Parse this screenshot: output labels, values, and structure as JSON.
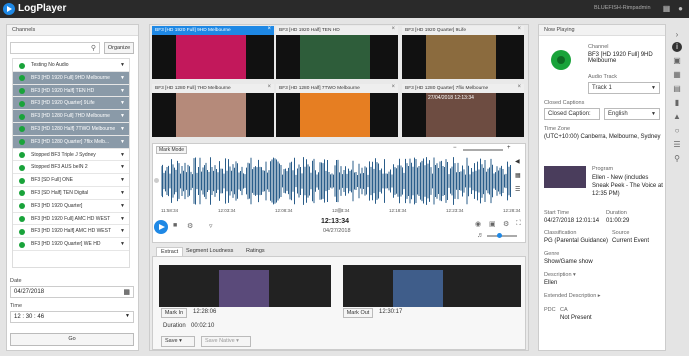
{
  "app": {
    "title": "LogPlayer",
    "user": "BLUEFISH-Rimpadmin"
  },
  "channels": {
    "header": "Channels",
    "organize_label": "Organize",
    "items": [
      {
        "label": "Testing No Audio",
        "selected": false
      },
      {
        "label": "BF3 [HD 1920 Full] 9HD Melbourne",
        "selected": true
      },
      {
        "label": "BF3 [HD 1920 Half] TEN HD",
        "selected": true
      },
      {
        "label": "BF3 [HD 1920 Quarter] 9Life",
        "selected": true
      },
      {
        "label": "BF3 [HD 1280 Full] 7HD Melbourne",
        "selected": true
      },
      {
        "label": "BF3 [HD 1280 Half] 7TWO Melbourne",
        "selected": true
      },
      {
        "label": "BF3 [HD 1280 Quarter] 7flix Melb...",
        "selected": true
      },
      {
        "label": "Stopped BF3 Triple J Sydney",
        "selected": false
      },
      {
        "label": "Stopped BF3 AUS beIN 2",
        "selected": false
      },
      {
        "label": "BF3 [SD Full] ONE",
        "selected": false
      },
      {
        "label": "BF3 [SD Half] TEN Digital",
        "selected": false
      },
      {
        "label": "BF3 [HD 1920 Quarter]",
        "selected": false
      },
      {
        "label": "BF3 [HD 1920 Full] AMC HD WEST",
        "selected": false
      },
      {
        "label": "BF3 [HD 1920 Half] AMC HD WEST",
        "selected": false
      },
      {
        "label": "BF3 [HD 1920 Quarter] WE HD",
        "selected": false
      }
    ],
    "date_label": "Date",
    "date_value": "04/27/2018",
    "time_label": "Time",
    "time_h": "12",
    "time_m": "30",
    "time_s": "46",
    "go_label": "Go"
  },
  "monitors": [
    {
      "label": "BF3 [HD 1920 Full] 9HD Melbourne",
      "active": true,
      "color": "#c2185b"
    },
    {
      "label": "BF3 [HD 1920 Half] TEN HD",
      "active": false,
      "color": "#2e5d3a"
    },
    {
      "label": "BF3 [HD 1920 Quarter] 9Life",
      "active": false,
      "color": "#8b6b3e"
    },
    {
      "label": "BF3 [HD 1280 Full] 7HD Melbourne",
      "active": false,
      "color": "#b58a7a"
    },
    {
      "label": "BF3 [HD 1280 Half] 7TWO Melbourne",
      "active": false,
      "color": "#e67e22"
    },
    {
      "label": "BF3 [HD 1280 Quarter] 7flix Melbourne",
      "active": false,
      "color": "#6d4c41"
    }
  ],
  "monitor_overlay": {
    "date": "27/04/2018",
    "time": "12:13:34"
  },
  "timeline": {
    "mark_mode_label": "Mark Mode",
    "ticks": [
      "11:58:34",
      "12:03:34",
      "12:08:34",
      "12:13:34",
      "12:18:34",
      "12:23:34",
      "12:28:34"
    ],
    "current_time": "12:13:34",
    "current_date": "04/27/2018"
  },
  "tabs": [
    "Extract",
    "Segment Loudness",
    "Ratings"
  ],
  "extract": {
    "mark_in_label": "Mark In",
    "mark_in_time": "12:28:06",
    "mark_out_label": "Mark Out",
    "mark_out_time": "12:30:17",
    "duration_label": "Duration",
    "duration_value": "00:02:10",
    "save_label": "Save",
    "save_native_label": "Save Native"
  },
  "now_playing": {
    "header": "Now Playing",
    "channel_label": "Channel",
    "channel_value": "BF3 [HD 1920 Full] 9HD Melbourne",
    "audio_track_label": "Audio Track",
    "audio_track_value": "Track 1",
    "cc_label": "Closed Captions",
    "cc_value": "Closed Caption:",
    "cc_lang": "English",
    "tz_label": "Time Zone",
    "tz_value": "(UTC+10:00) Canberra, Melbourne, Sydney",
    "program_label": "Program",
    "program_value": "Ellen - New (includes Sneak Peek - The Voice at 12:35 PM)",
    "start_label": "Start Time",
    "start_value": "04/27/2018 12:01:14",
    "duration_label": "Duration",
    "duration_value": "01:00:29",
    "class_label": "Classification",
    "class_value": "PG (Parental Guidance)",
    "source_label": "Source",
    "source_value": "Current Event",
    "genre_label": "Genre",
    "genre_value": "Show/Game show",
    "desc_label": "Description",
    "desc_value": "Ellen",
    "ext_desc_label": "Extended Description",
    "pdc_label": "PDC",
    "ca_label": "CA",
    "pdc_value": "Not Present"
  }
}
